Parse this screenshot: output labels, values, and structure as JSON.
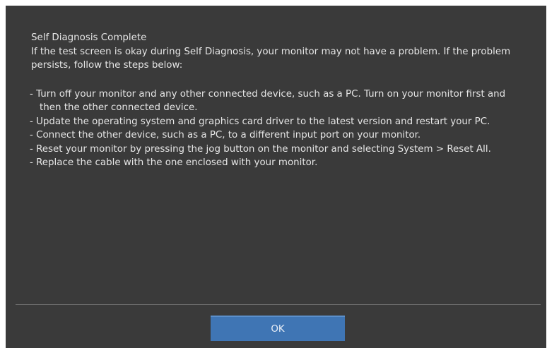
{
  "dialog": {
    "title": "Self Diagnosis Complete",
    "intro": "If the test screen is okay during Self Diagnosis, your monitor may not have a  problem. If the problem persists, follow the  steps below:",
    "steps": [
      "- Turn off your monitor and any other connected device, such as a PC. Turn on your monitor first and then the other connected device.",
      "- Update the operating system and graphics card driver to the latest version and restart your PC.",
      "- Connect the other device, such as a PC, to a different input port on your monitor.",
      "- Reset your monitor by pressing the jog button on the monitor and selecting System > Reset All.",
      "- Replace the cable with the one enclosed with your monitor."
    ],
    "ok_label": "OK"
  },
  "colors": {
    "background": "#3a3a3a",
    "text": "#e6e6e6",
    "button": "#3f75b4",
    "divider": "#6e6e6e"
  }
}
